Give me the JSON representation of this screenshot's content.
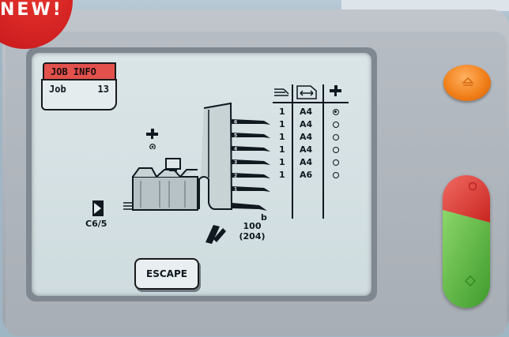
{
  "badge": {
    "label": "NEW!"
  },
  "lcd": {
    "job_tab_label": "JOB INFO",
    "job": {
      "label": "Job",
      "number": "13"
    },
    "table": {
      "header_icons": [
        "stack-icon",
        "insert-fold-icon",
        "daily-mail-icon"
      ],
      "rows": [
        {
          "qty": "1",
          "size": "A4",
          "selected": true
        },
        {
          "qty": "1",
          "size": "A4",
          "selected": false
        },
        {
          "qty": "1",
          "size": "A4",
          "selected": false
        },
        {
          "qty": "1",
          "size": "A4",
          "selected": false
        },
        {
          "qty": "1",
          "size": "A4",
          "selected": false
        },
        {
          "qty": "1",
          "size": "A6",
          "selected": false
        }
      ]
    },
    "feeder_labels": [
      "6",
      "5",
      "4",
      "3",
      "2",
      "1"
    ],
    "feeder_b_label": "b",
    "envelope": {
      "label": "C6/5",
      "icon": "envelope-icon"
    },
    "counter": {
      "value": "100",
      "sub": "(204)",
      "icon": "output-stack-icon"
    },
    "daily_mail_icon": "daily-mail-icon",
    "escape_label": "ESCAPE"
  },
  "colors": {
    "badge_red": "#d1201f",
    "tab_red": "#e2514c",
    "lcd_bg": "#d5e0e3",
    "orange": "#f07d16",
    "stop_red": "#e2433f",
    "start_green": "#59b543"
  },
  "hardware": {
    "orange_button_icon": "eject-icon",
    "stop_button_icon": "stop-icon",
    "start_button_icon": "start-icon"
  }
}
